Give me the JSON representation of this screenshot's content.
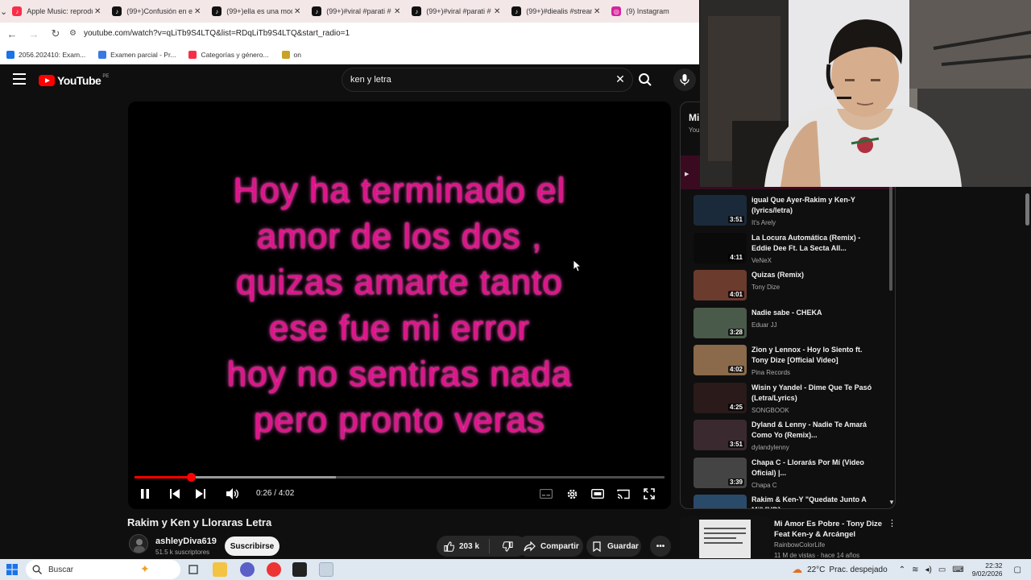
{
  "browser": {
    "tabs": [
      {
        "title": "Apple Music: reproduc",
        "fav_color": "#fa2d48",
        "fav_glyph": "♪"
      },
      {
        "title": "(99+)Confusión en el",
        "fav_color": "#111111",
        "fav_glyph": "♪"
      },
      {
        "title": "(99+)ella es una mod",
        "fav_color": "#111111",
        "fav_glyph": "♪"
      },
      {
        "title": "(99+)#viral #parati #",
        "fav_color": "#111111",
        "fav_glyph": "♪"
      },
      {
        "title": "(99+)#viral #parati #",
        "fav_color": "#111111",
        "fav_glyph": "♪"
      },
      {
        "title": "(99+)#diealis #stream",
        "fav_color": "#111111",
        "fav_glyph": "♪"
      },
      {
        "title": "(9) Instagram",
        "fav_color": "#d6249f",
        "fav_glyph": "◎"
      }
    ],
    "url": "youtube.com/watch?v=qLiTb9S4LTQ&list=RDqLiTb9S4LTQ&start_radio=1",
    "bookmarks": [
      {
        "label": "2056.202410: Exam...",
        "color": "#1a73e8"
      },
      {
        "label": "Examen parcial - Pr...",
        "color": "#3b78e7"
      },
      {
        "label": "Categorías y género...",
        "color": "#fa2d48"
      },
      {
        "label": "on",
        "color": "#c9a227"
      }
    ]
  },
  "header": {
    "logo_text": "YouTube",
    "country": "PE",
    "search_value": "ken y letra"
  },
  "player": {
    "lyrics": [
      "Hoy ha terminado el",
      "amor de los dos ,",
      "quizas amarte tanto",
      "ese fue mi error",
      "hoy no sentiras nada",
      "pero pronto veras"
    ],
    "time_current": "0:26",
    "time_total": "4:02",
    "played_fraction": 0.107,
    "loaded_fraction": 0.38,
    "colors": {
      "lyrics": "#e0148a",
      "progress": "#ff0000"
    }
  },
  "video": {
    "title": "Rakim y Ken y Lloraras Letra",
    "channel": "ashleyDiva619",
    "subscribers": "51.5 k suscriptores",
    "subscribe_label": "Suscribirse",
    "likes": "203 k",
    "share_label": "Compartir",
    "save_label": "Guardar"
  },
  "playlist": {
    "title": "Mi",
    "subtitle": "You",
    "items": [
      {
        "title": "igual Que Ayer-Rakim y Ken-Y (lyrics/letra)",
        "channel": "It's Arely",
        "duration": "3:51",
        "thumb": "#1b2a3a"
      },
      {
        "title": "La Locura Automática (Remix) - Eddie Dee Ft. La Secta All...",
        "channel": "VeNeX",
        "duration": "4:11",
        "thumb": "#0a0a0a"
      },
      {
        "title": "Quizas (Remix)",
        "channel": "Tony Dize",
        "duration": "4:01",
        "thumb": "#6b3b2e"
      },
      {
        "title": "Nadie sabe - CHEKA",
        "channel": "Eduar JJ",
        "duration": "3:28",
        "thumb": "#4a5a4a"
      },
      {
        "title": "Zion y Lennox - Hoy lo Siento ft. Tony Dize [Official Video]",
        "channel": "Pina Records",
        "duration": "4:02",
        "thumb": "#8a6a4a"
      },
      {
        "title": "Wisin y Yandel - Dime Que Te Pasó (Letra/Lyrics)",
        "channel": "SONGBOOK",
        "duration": "4:25",
        "thumb": "#2a1a1a"
      },
      {
        "title": "Dyland & Lenny - Nadie Te Amará Como Yo (Remix)...",
        "channel": "dylandylenny",
        "duration": "3:51",
        "thumb": "#3a2a30"
      },
      {
        "title": "Chapa C - Llorarás Por Mí (Video Oficial) |...",
        "channel": "Chapa C",
        "duration": "3:39",
        "thumb": "#444444"
      },
      {
        "title": "Rakim & Ken-Y \"Quedate Junto A Mi\" [HD]",
        "channel": "",
        "duration": "",
        "thumb": "#2a4a6a"
      }
    ]
  },
  "recommendation": {
    "title": "Mi Amor Es Pobre - Tony Dize Feat Ken-y & Arcángel",
    "channel": "RainbowColorLife",
    "meta": "11 M de vistas · hace 14 años"
  },
  "taskbar": {
    "search_placeholder": "Buscar",
    "temperature": "22°C",
    "weather": "Prac. despejado",
    "time": "22:32",
    "date": "9/02/2026"
  }
}
